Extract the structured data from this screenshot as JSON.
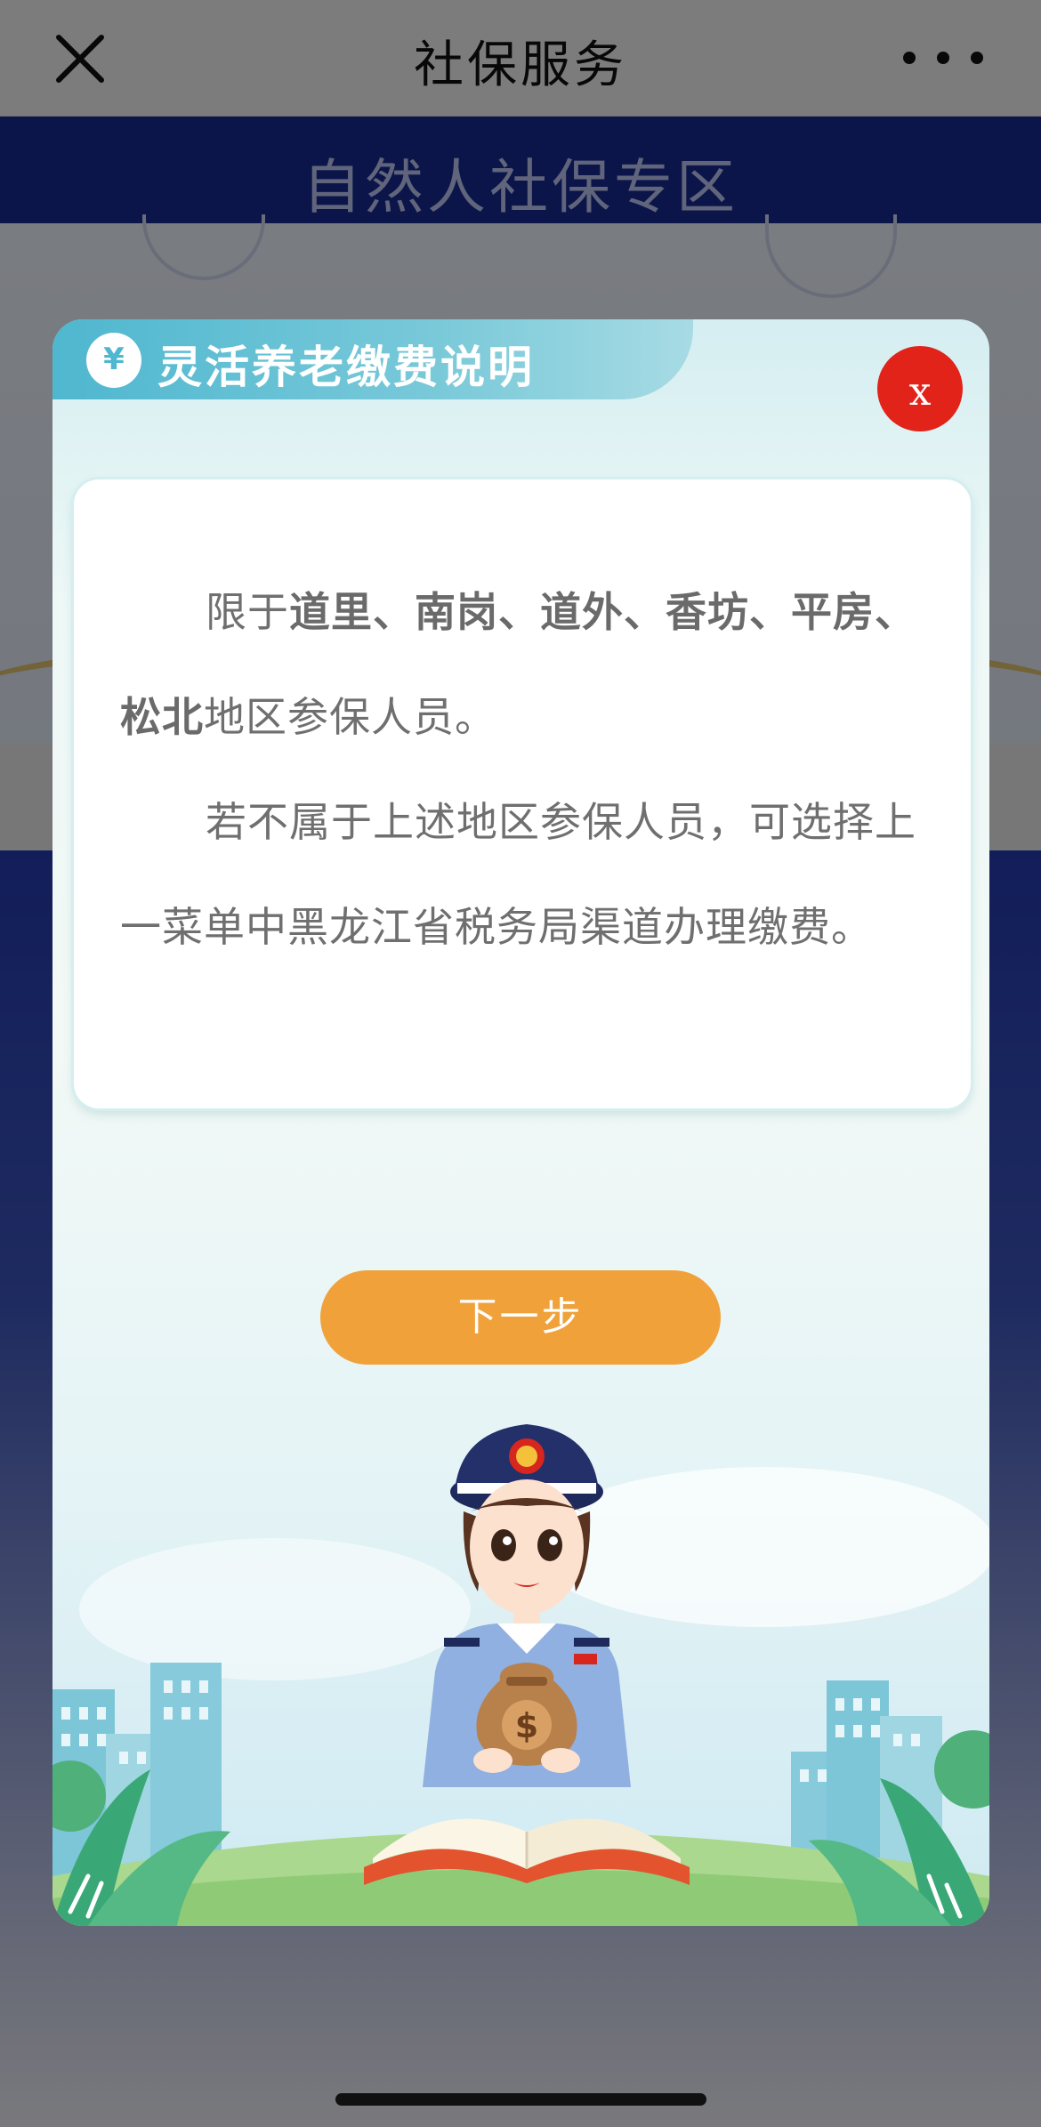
{
  "navbar": {
    "title": "社保服务",
    "close_icon": "close-icon",
    "more_icon": "more-dots-icon"
  },
  "page": {
    "banner_title": "自然人社保专区"
  },
  "modal": {
    "title": "灵活养老缴费说明",
    "title_icon_glyph": "¥",
    "close_label": "x",
    "notice": {
      "p1_prefix": "限于",
      "p1_regions_a": "道里、南岗、道外、香坊、平房、",
      "p1_regions_b": "松北",
      "p1_suffix": "地区参保人员。",
      "p2": "若不属于上述地区参保人员，可选择上一菜单中黑龙江省税务局渠道办理缴费。"
    },
    "next_button": "下一步"
  },
  "colors": {
    "accent_orange": "#f0a13a",
    "close_red": "#e2231a",
    "teal": "#4fb7cf",
    "banner_blue": "#182a8f"
  }
}
